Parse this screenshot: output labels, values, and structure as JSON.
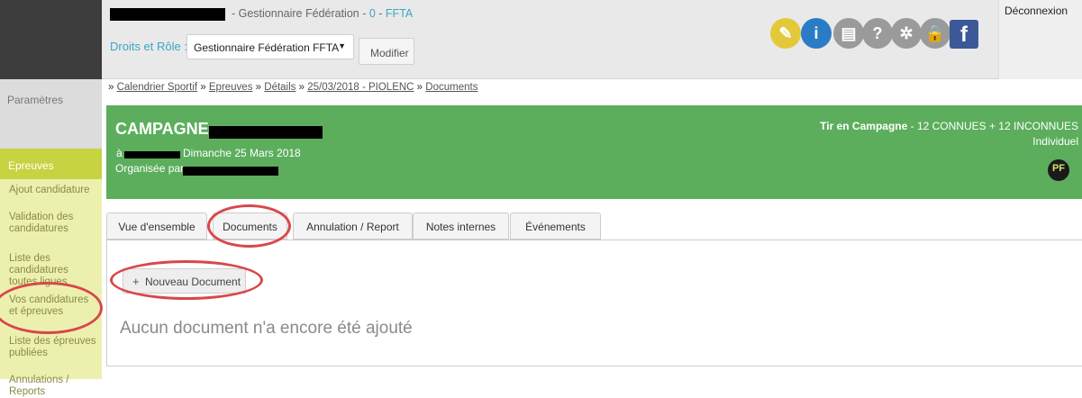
{
  "header": {
    "role_title_suffix": "- Gestionnaire Fédération - ",
    "role_num": "0",
    "role_sep": " - ",
    "role_org": "FFTA",
    "droits_label": "Droits et Rôle :",
    "role_selected": "Gestionnaire Fédération FFTA",
    "modify_label": "Modifier",
    "logout_label": "Déconnexion",
    "icons": [
      "search-icon",
      "help-people-icon",
      "document-icon",
      "question-icon",
      "gear-icon",
      "lock-icon",
      "facebook-icon"
    ],
    "icon_colors": [
      "#e3c83a",
      "#2a7cc6",
      "#9a9a9a",
      "#9a9a9a",
      "#9a9a9a",
      "#9a9a9a",
      "#3b5998"
    ],
    "icon_glyphs": [
      "✎",
      "i",
      "▤",
      "?",
      "✲",
      "🔒",
      "f"
    ],
    "facebook_glyph": "f"
  },
  "sidebar": {
    "parametres": "Paramètres",
    "section_title": "Epreuves",
    "items": [
      "Ajout candidature",
      "Validation des candidatures",
      "Liste des candidatures toutes ligues",
      "Vos candidatures et épreuves",
      "Liste des épreuves publiées",
      "Annulations / Reports"
    ]
  },
  "breadcrumb": {
    "prefix": "» ",
    "sep": " » ",
    "items": [
      "Calendrier Sportif",
      "Epreuves",
      "Détails",
      "25/03/2018 - PIOLENC",
      "Documents"
    ]
  },
  "event": {
    "title": "CAMPAGNE",
    "a_label": "à",
    "date": "Dimanche 25 Mars 2018",
    "organised_by": "Organisée par",
    "discipline": "Tir en Campagne",
    "discipline_detail": " - 12 CONNUES + 12 INCONNUES",
    "type": "Individuel",
    "badge": "PF"
  },
  "tabs": [
    {
      "label": "Vue d'ensemble",
      "active": false
    },
    {
      "label": "Documents",
      "active": true
    },
    {
      "label": "Annulation / Report",
      "active": false
    },
    {
      "label": "Notes internes",
      "active": false
    },
    {
      "label": "Événements",
      "active": false
    }
  ],
  "content": {
    "new_doc_plus": "+",
    "new_doc_label": "Nouveau Document",
    "empty_message": "Aucun document n'a encore été ajouté"
  },
  "colors": {
    "accent": "#3aa6c8",
    "banner": "#5cae5d",
    "sidebar_section": "#c7d341",
    "annotation": "#d9474b"
  }
}
